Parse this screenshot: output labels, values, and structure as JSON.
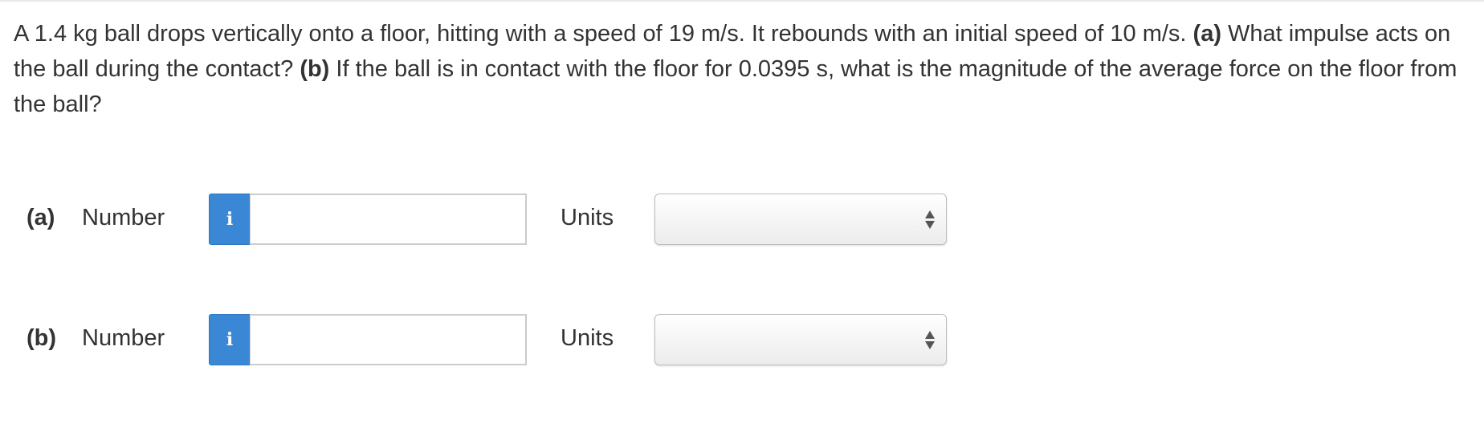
{
  "question": {
    "text_1": "A 1.4 kg ball drops vertically onto a floor, hitting with a speed of 19 m/s. It rebounds with an initial speed of 10 m/s. ",
    "part_a_marker": "(a)",
    "text_2": " What impulse acts on the ball during the contact? ",
    "part_b_marker": "(b)",
    "text_3": " If the ball is in contact with the floor for 0.0395 s, what is the magnitude of the average force on the floor from the ball?"
  },
  "answers": [
    {
      "part_label": "(a)",
      "number_label": "Number",
      "info_icon": "i",
      "number_value": "",
      "units_label": "Units",
      "units_selected": ""
    },
    {
      "part_label": "(b)",
      "number_label": "Number",
      "info_icon": "i",
      "number_value": "",
      "units_label": "Units",
      "units_selected": ""
    }
  ],
  "colors": {
    "info_button_bg": "#3a87d6",
    "text": "#333333"
  }
}
